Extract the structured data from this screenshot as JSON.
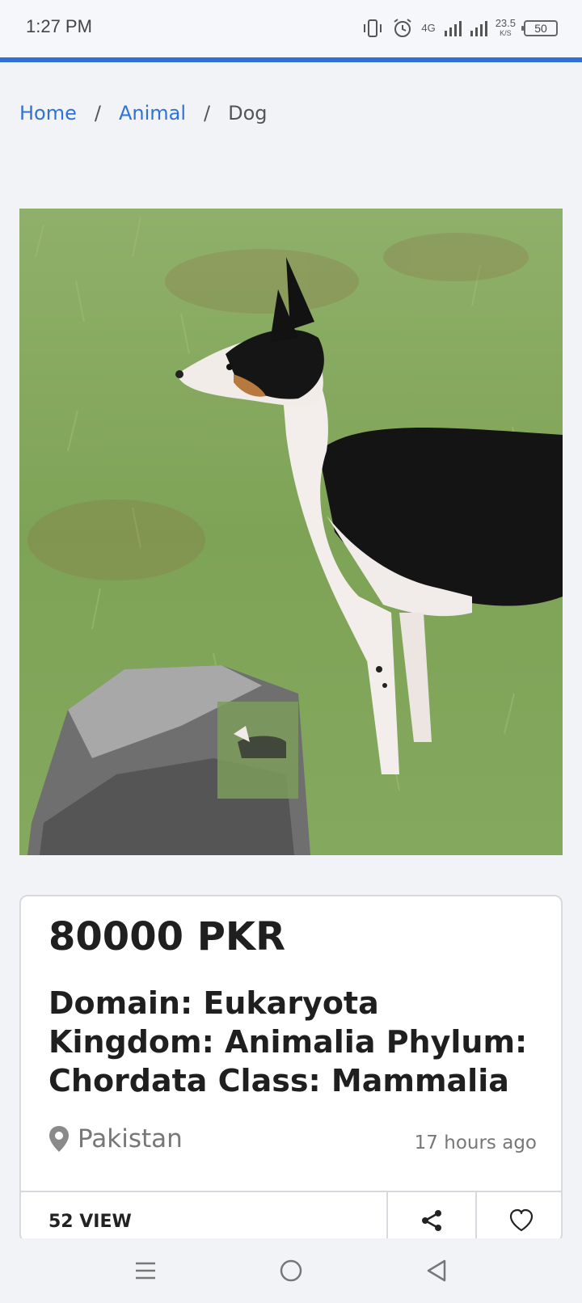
{
  "status_bar": {
    "time": "1:27 PM",
    "network_label": "4G",
    "net_speed_value": "23.5",
    "net_speed_unit": "K/S",
    "battery": "50"
  },
  "breadcrumb": {
    "items": [
      {
        "label": "Home",
        "link": true
      },
      {
        "label": "Animal",
        "link": true
      },
      {
        "label": "Dog",
        "link": false
      }
    ],
    "separator": "/"
  },
  "listing": {
    "price": "80000 PKR",
    "title": "Domain: Eukaryota Kingdom: Animalia Phylum: Chordata Class: Mammalia",
    "location": "Pakistan",
    "posted": "17 hours ago",
    "views": "52 VIEW"
  },
  "icons": {
    "location": "map-pin-icon",
    "share": "share-icon",
    "favorite": "heart-icon",
    "nav_menu": "menu-icon",
    "nav_home": "home-circle-icon",
    "nav_back": "back-triangle-icon"
  },
  "colors": {
    "accent": "#2f6fd6",
    "link": "#2f73d8",
    "background": "#f1f3f7"
  }
}
